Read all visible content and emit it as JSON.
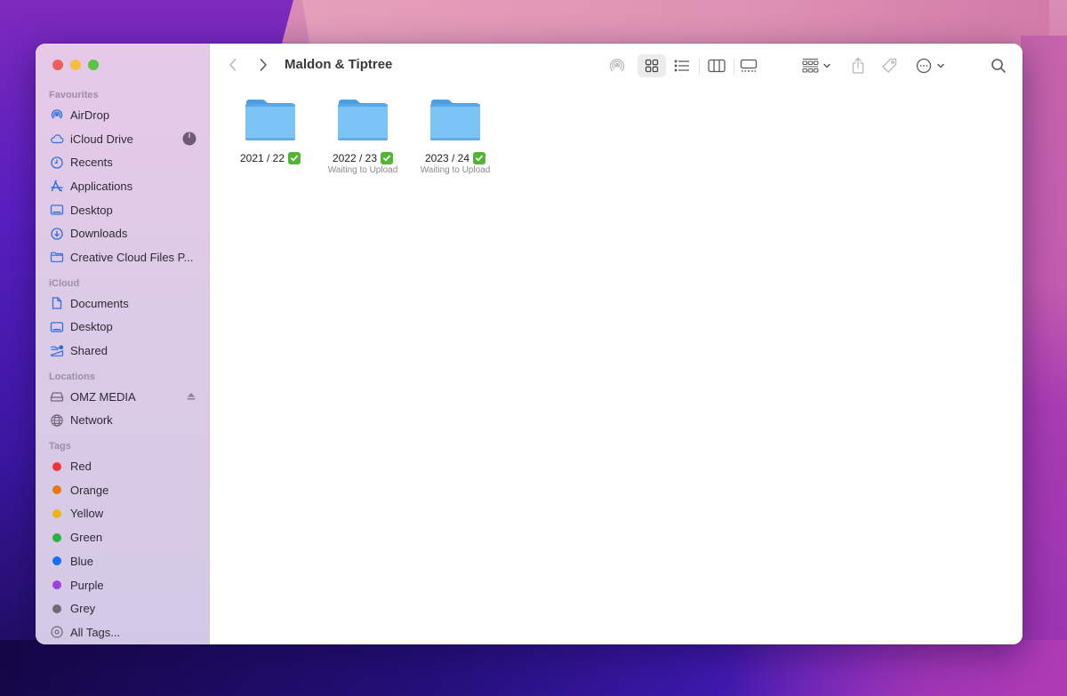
{
  "window": {
    "title": "Maldon & Tiptree"
  },
  "sidebar": {
    "sections": [
      {
        "title": "Favourites",
        "items": [
          {
            "label": "AirDrop",
            "icon": "airdrop-icon"
          },
          {
            "label": "iCloud Drive",
            "icon": "cloud-icon",
            "trailing": "sync-progress-icon"
          },
          {
            "label": "Recents",
            "icon": "clock-icon"
          },
          {
            "label": "Applications",
            "icon": "applications-icon"
          },
          {
            "label": "Desktop",
            "icon": "desktop-icon"
          },
          {
            "label": "Downloads",
            "icon": "download-icon"
          },
          {
            "label": "Creative Cloud Files P...",
            "icon": "folder-icon"
          }
        ]
      },
      {
        "title": "iCloud",
        "items": [
          {
            "label": "Documents",
            "icon": "document-icon"
          },
          {
            "label": "Desktop",
            "icon": "desktop-icon"
          },
          {
            "label": "Shared",
            "icon": "shared-folder-icon"
          }
        ]
      },
      {
        "title": "Locations",
        "items": [
          {
            "label": "OMZ MEDIA",
            "icon": "drive-icon",
            "trailing": "eject-icon"
          },
          {
            "label": "Network",
            "icon": "globe-icon"
          }
        ]
      },
      {
        "title": "Tags",
        "items": [
          {
            "label": "Red",
            "color": "#f0343c"
          },
          {
            "label": "Orange",
            "color": "#e8780f"
          },
          {
            "label": "Yellow",
            "color": "#eab514"
          },
          {
            "label": "Green",
            "color": "#27b33d"
          },
          {
            "label": "Blue",
            "color": "#1a6ef5"
          },
          {
            "label": "Purple",
            "color": "#9a45d6"
          },
          {
            "label": "Grey",
            "color": "#6e6c74"
          },
          {
            "label": "All Tags..."
          }
        ]
      }
    ]
  },
  "toolbar": {
    "back": "chevron-left-icon",
    "forward": "chevron-right-icon",
    "buttons": [
      "airdrop",
      "icon-view",
      "list-view",
      "column-view",
      "gallery-view",
      "group-by",
      "share",
      "tags",
      "more-actions",
      "search"
    ],
    "active_view": "icon-view"
  },
  "files": [
    {
      "name": "2021 / 22",
      "status": "",
      "synced": true
    },
    {
      "name": "2022 / 23",
      "status": "Waiting to Upload",
      "synced": true
    },
    {
      "name": "2023 / 24",
      "status": "Waiting to Upload",
      "synced": true
    }
  ],
  "colors": {
    "accent": "#2f6fe0",
    "folder": "#7cc3f5",
    "folder_dark": "#5aa7e3",
    "check": "#54b435"
  }
}
